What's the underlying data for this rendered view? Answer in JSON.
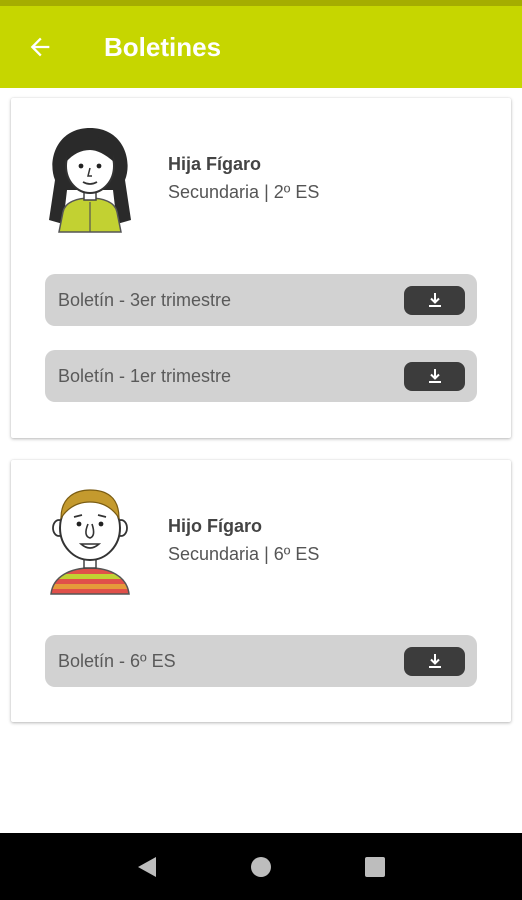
{
  "app_bar": {
    "title": "Boletines",
    "back_icon": "arrow-left-icon",
    "color": "#c6d600"
  },
  "students": [
    {
      "name": "Hija Fígaro",
      "level": "Secundaria | 2º ES",
      "avatar_icon": "girl-avatar-icon",
      "reports": [
        {
          "label": "Boletín - 3er trimestre",
          "action_icon": "download-icon"
        },
        {
          "label": "Boletín - 1er trimestre",
          "action_icon": "download-icon"
        }
      ]
    },
    {
      "name": "Hijo Fígaro",
      "level": "Secundaria | 6º ES",
      "avatar_icon": "boy-avatar-icon",
      "reports": [
        {
          "label": "Boletín - 6º ES",
          "action_icon": "download-icon"
        }
      ]
    }
  ],
  "nav_bar": {
    "buttons": [
      "back-triangle-icon",
      "home-circle-icon",
      "recents-square-icon"
    ]
  }
}
